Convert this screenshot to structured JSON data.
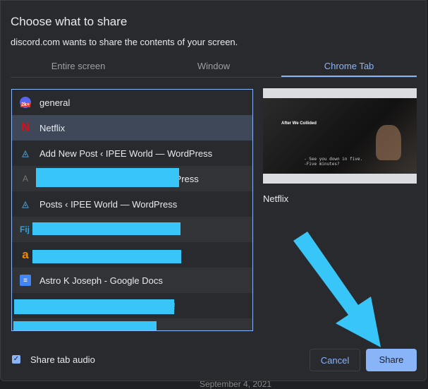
{
  "dialog": {
    "title": "Choose what to share",
    "subtitle": "discord.com wants to share the contents of your screen."
  },
  "tabs": [
    {
      "label": "Entire screen"
    },
    {
      "label": "Window"
    },
    {
      "label": "Chrome Tab",
      "active": true
    }
  ],
  "tab_list": [
    {
      "label": "general",
      "icon": "discord-server-icon"
    },
    {
      "label": "Netflix",
      "icon": "netflix-icon",
      "selected": true
    },
    {
      "label": "Add New Post ‹ IPEE World — WordPress",
      "icon": "wordpress-site-icon"
    },
    {
      "label": "rdPress",
      "icon": "generic-favicon",
      "redacted": true
    },
    {
      "label": "Posts ‹ IPEE World — WordPress",
      "icon": "wordpress-site-icon"
    },
    {
      "label": "Fij",
      "icon": "fiji-icon",
      "redacted": true
    },
    {
      "label": "",
      "icon": "amazon-icon",
      "redacted": true
    },
    {
      "label": "Astro K Joseph - Google Docs",
      "icon": "google-docs-icon"
    },
    {
      "label": "!",
      "icon": "yellow-favicon",
      "redacted": true
    },
    {
      "label": "",
      "icon": "",
      "redacted": true
    }
  ],
  "preview": {
    "title": "Netflix",
    "video_title": "After We Collided",
    "subtitle_line1": "- See you down in five.",
    "subtitle_line2": "-Five minutes?"
  },
  "footer": {
    "audio_label": "Share tab audio",
    "audio_checked": true,
    "cancel": "Cancel",
    "share": "Share"
  },
  "background_text": "September 4, 2021",
  "colors": {
    "accent": "#8ab4f8",
    "annotation": "#38c6f9",
    "selected_row": "#3f4858"
  }
}
